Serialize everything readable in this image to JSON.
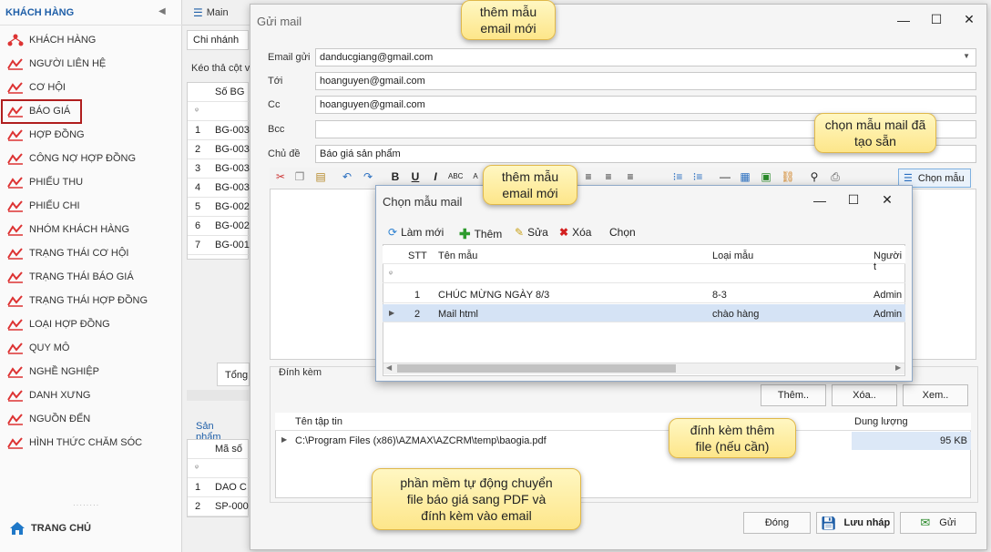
{
  "sidebar": {
    "title": "KHÁCH HÀNG",
    "items": [
      {
        "label": "KHÁCH HÀNG",
        "icon": "people-tree-icon"
      },
      {
        "label": "NGƯỜI LIÊN HỆ",
        "icon": "chart-icon"
      },
      {
        "label": "CƠ HỘI",
        "icon": "chart-icon"
      },
      {
        "label": "BÁO GIÁ",
        "icon": "chart-icon"
      },
      {
        "label": "HỢP ĐỒNG",
        "icon": "chart-icon"
      },
      {
        "label": "CÔNG NỢ HỢP ĐỒNG",
        "icon": "chart-icon"
      },
      {
        "label": "PHIẾU THU",
        "icon": "chart-icon"
      },
      {
        "label": "PHIẾU CHI",
        "icon": "chart-icon"
      },
      {
        "label": "NHÓM KHÁCH HÀNG",
        "icon": "chart-icon"
      },
      {
        "label": "TRẠNG THÁI CƠ HỘI",
        "icon": "chart-icon"
      },
      {
        "label": "TRẠNG THÁI BÁO GIÁ",
        "icon": "chart-icon"
      },
      {
        "label": "TRẠNG THÁI HỢP ĐỒNG",
        "icon": "chart-icon"
      },
      {
        "label": "LOẠI HỢP ĐỒNG",
        "icon": "chart-icon"
      },
      {
        "label": "QUY MÔ",
        "icon": "chart-icon"
      },
      {
        "label": "NGHỀ NGHIỆP",
        "icon": "chart-icon"
      },
      {
        "label": "DANH XƯNG",
        "icon": "chart-icon"
      },
      {
        "label": "NGUỒN ĐẾN",
        "icon": "chart-icon"
      },
      {
        "label": "HÌNH THỨC CHĂM SÓC",
        "icon": "chart-icon"
      }
    ],
    "footer": "TRANG CHỦ"
  },
  "background": {
    "tab_main": "Main",
    "subtab": "Chi nhánh",
    "drag_hint": "Kéo thả cột v",
    "col_header": "Số BG",
    "rows": [
      {
        "n": "1",
        "v": "BG-003"
      },
      {
        "n": "2",
        "v": "BG-003"
      },
      {
        "n": "3",
        "v": "BG-003"
      },
      {
        "n": "4",
        "v": "BG-003"
      },
      {
        "n": "5",
        "v": "BG-002"
      },
      {
        "n": "6",
        "v": "BG-002"
      },
      {
        "n": "7",
        "v": "BG-001"
      }
    ],
    "total_label": "Tổng",
    "products_tab": "Sản phẩm",
    "products_header": "Mã số",
    "products_rows": [
      {
        "n": "1",
        "v": "DAO C"
      },
      {
        "n": "2",
        "v": "SP-000"
      }
    ]
  },
  "mail": {
    "title": "Gửi mail",
    "labels": {
      "from": "Email gửi",
      "to": "Tới",
      "cc": "Cc",
      "bcc": "Bcc",
      "subject": "Chủ đề"
    },
    "values": {
      "from": "danducgiang@gmail.com",
      "to": "hoanguyen@gmail.com",
      "cc": "hoanguyen@gmail.com",
      "bcc": "",
      "subject": "Báo giá sản phẩm"
    },
    "choose_template": "Chọn mẫu",
    "attach_legend": "Đính kèm",
    "attach_buttons": {
      "add": "Thêm..",
      "remove": "Xóa..",
      "view": "Xem.."
    },
    "attach_headers": {
      "name": "Tên tập tin",
      "size": "Dung lượng"
    },
    "attachment": {
      "path": "C:\\Program Files (x86)\\AZMAX\\AZCRM\\temp\\baogia.pdf",
      "size": "95 KB"
    },
    "footer_buttons": {
      "close": "Đóng",
      "save_draft": "Lưu nháp",
      "send": "Gửi"
    }
  },
  "template_dialog": {
    "title": "Chọn mẫu mail",
    "toolbar": {
      "refresh": "Làm mới",
      "add": "Thêm",
      "edit": "Sửa",
      "delete": "Xóa",
      "choose": "Chọn"
    },
    "headers": {
      "stt": "STT",
      "name": "Tên mẫu",
      "type": "Loại mẫu",
      "person": "Người t"
    },
    "rows": [
      {
        "stt": "1",
        "name": "CHÚC MỪNG NGÀY 8/3",
        "type": "8-3",
        "person": "Admin"
      },
      {
        "stt": "2",
        "name": "Mail html",
        "type": "chào hàng",
        "person": "Admin"
      }
    ]
  },
  "callouts": {
    "new_template_top": "thêm mẫu\nemail mới",
    "choose_existing": "chọn mẫu mail đã\ntạo sẵn",
    "new_template_mid": "thêm mẫu\nemail mới",
    "attach_file": "đính kèm thêm\nfile (nếu cần)",
    "auto_pdf": "phần mềm tự động chuyển\nfile báo giá sang PDF và\nđính kèm vào email"
  },
  "colors": {
    "accent": "#1f5fa8",
    "selected_border": "#b01e1e",
    "callout": "#fde68a",
    "row_selected": "#d5e3f5"
  }
}
